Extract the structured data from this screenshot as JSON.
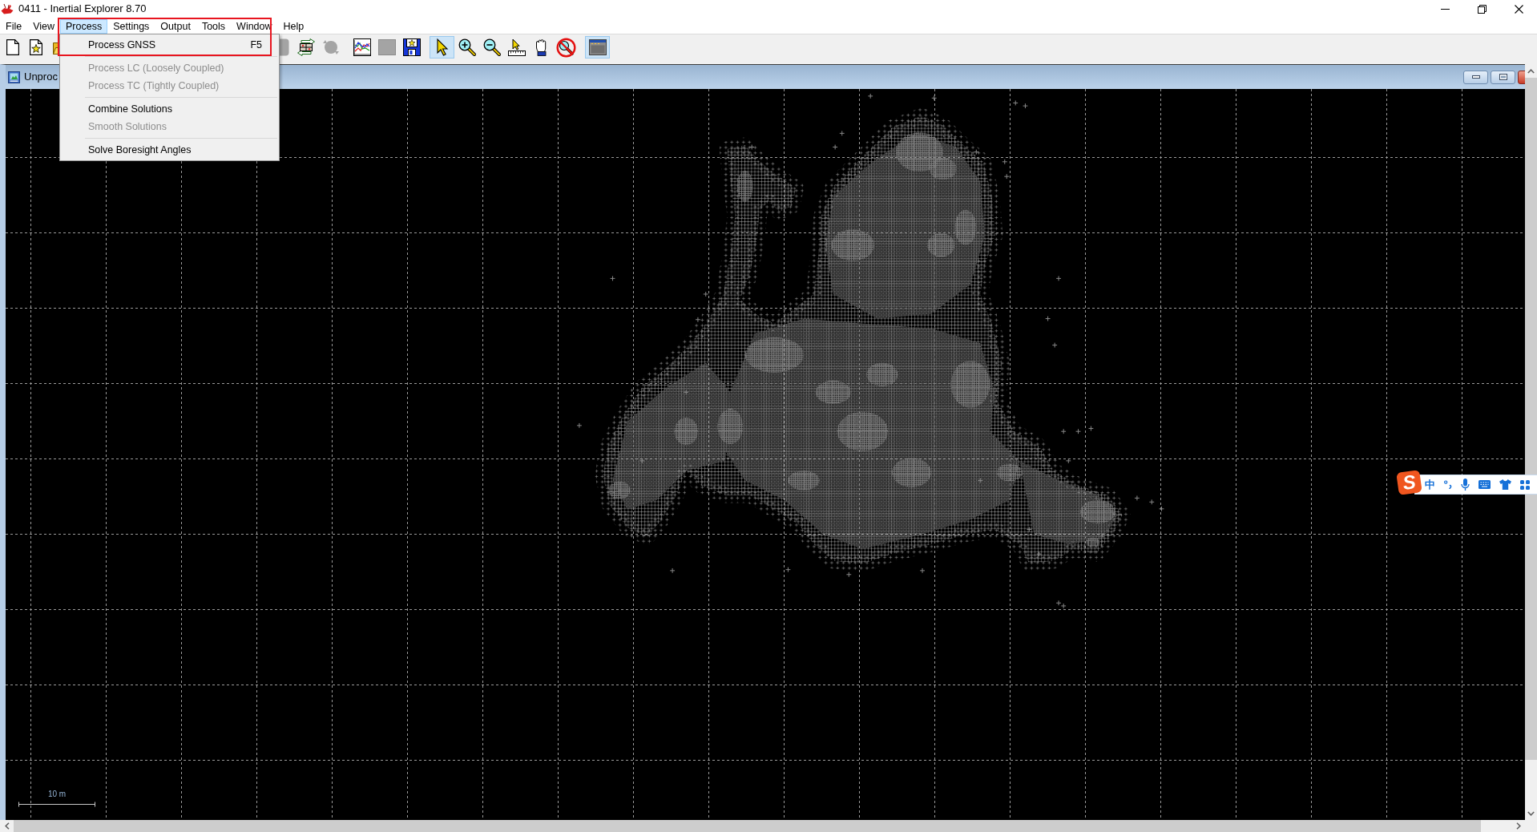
{
  "window": {
    "title": "0411 - Inertial Explorer 8.70"
  },
  "menu_bar": [
    {
      "label": "File",
      "selected": false
    },
    {
      "label": "View",
      "selected": false
    },
    {
      "label": "Process",
      "selected": true
    },
    {
      "label": "Settings",
      "selected": false
    },
    {
      "label": "Output",
      "selected": false
    },
    {
      "label": "Tools",
      "selected": false
    },
    {
      "label": "Window",
      "selected": false
    },
    {
      "label": "Help",
      "selected": false
    }
  ],
  "toolbar": [
    {
      "kind": "new",
      "selected": false,
      "disabled": false
    },
    {
      "kind": "favorite",
      "selected": false,
      "disabled": false
    },
    {
      "kind": "open",
      "selected": false,
      "disabled": false
    },
    {
      "kind": "panel",
      "selected": false,
      "disabled": true
    },
    {
      "kind": "transfer",
      "selected": false,
      "disabled": false
    },
    {
      "kind": "cycle",
      "selected": false,
      "disabled": true
    },
    {
      "kind": "chart",
      "selected": false,
      "disabled": false
    },
    {
      "kind": "grid",
      "selected": false,
      "disabled": true
    },
    {
      "kind": "save",
      "selected": false,
      "disabled": false
    },
    {
      "kind": "pointer",
      "selected": true,
      "disabled": false
    },
    {
      "kind": "zoom_in",
      "selected": false,
      "disabled": false
    },
    {
      "kind": "zoom_out",
      "selected": false,
      "disabled": false
    },
    {
      "kind": "measure",
      "selected": false,
      "disabled": false
    },
    {
      "kind": "pan",
      "selected": false,
      "disabled": false
    },
    {
      "kind": "zoom_reset",
      "selected": false,
      "disabled": false
    },
    {
      "kind": "window",
      "selected": true,
      "disabled": false
    }
  ],
  "process_menu": {
    "items": [
      {
        "kind": "item",
        "label": "Process GNSS",
        "shortcut": "F5",
        "disabled": false
      },
      {
        "kind": "separator"
      },
      {
        "kind": "item",
        "label": "Process LC (Loosely Coupled)",
        "disabled": true
      },
      {
        "kind": "item",
        "label": "Process TC (Tightly Coupled)",
        "disabled": true
      },
      {
        "kind": "separator"
      },
      {
        "kind": "item",
        "label": "Combine Solutions",
        "disabled": false
      },
      {
        "kind": "item",
        "label": "Smooth Solutions",
        "disabled": true
      },
      {
        "kind": "separator"
      },
      {
        "kind": "item",
        "label": "Solve Boresight Angles",
        "disabled": false
      }
    ]
  },
  "plot_window": {
    "title": "Unproc",
    "scale_label": "10 m"
  },
  "ime_toolbar": {
    "logo": "S",
    "mode": "中"
  }
}
